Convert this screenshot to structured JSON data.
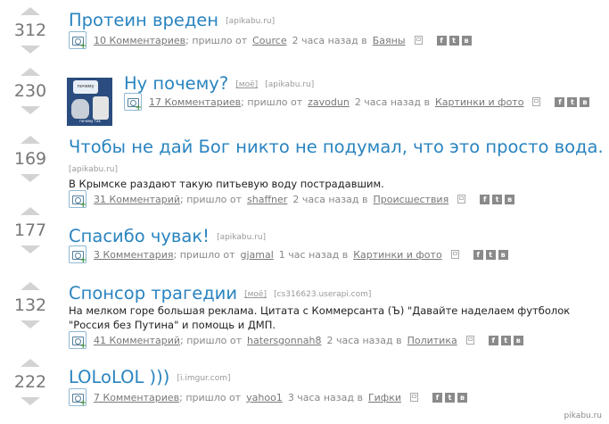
{
  "labels": {
    "mine": "[моё]",
    "fav_icon": "bookmark-icon"
  },
  "colors": {
    "title": "#2a84c0",
    "vote_arrow": "#d3d3d3",
    "rating": "#777777"
  },
  "posts": [
    {
      "rating": "312",
      "title": "Протеин вреден",
      "domain": "[apikabu.ru]",
      "comments": "10 Комментариев",
      "from_text": "; пришло от",
      "author": "Cource",
      "time": "2 часа назад в",
      "category": "Баяны"
    },
    {
      "rating": "230",
      "title": "Ну почему?",
      "domain": "[apikabu.ru]",
      "comments": "17 Комментариев",
      "from_text": "; пришло от",
      "author": "zavodun",
      "time": "2 часа назад в",
      "category": "Картинки и фото",
      "thumb": {
        "bubble": "почему",
        "caption": "почему так"
      }
    },
    {
      "rating": "169",
      "title": "Чтобы не дай Бог никто не подумал, что это просто вода.",
      "domain": "[apikabu.ru]",
      "description": "В Крымске раздают такую питьевую воду пострадавшим.",
      "comments": "31 Комментарий",
      "from_text": "; пришло от",
      "author": "shaffner",
      "time": "2 часа назад в",
      "category": "Происшествия"
    },
    {
      "rating": "177",
      "title": "Спасибо чувак!",
      "domain": "[apikabu.ru]",
      "comments": "3 Комментария",
      "from_text": "; пришло от",
      "author": "gjamal",
      "time": "1 час назад в",
      "category": "Картинки и фото"
    },
    {
      "rating": "132",
      "title": "Спонсор трагедии",
      "domain": "[cs316623.userapi.com]",
      "description_line1": "На мелком горе большая реклама. Цитата с Коммерсанта (Ъ) \"Давайте наделаем футболок",
      "description_line2": "\"Россия без Путина\" и помощь и ДМП.",
      "comments": "41 Комментарий",
      "from_text": "; пришло от",
      "author": "hatersgonnah8",
      "time": "2 часа назад в",
      "category": "Политика"
    },
    {
      "rating": "222",
      "title": "LOLoLOL )))",
      "domain": "[i.imgur.com]",
      "comments": "7 Комментариев",
      "from_text": "; пришло от",
      "author": "yahoo1",
      "time": "3 часа назад в",
      "category": "Гифки"
    }
  ],
  "social": {
    "fb": "f",
    "tw": "t",
    "vk": "в"
  },
  "watermark": "pikabu.ru"
}
